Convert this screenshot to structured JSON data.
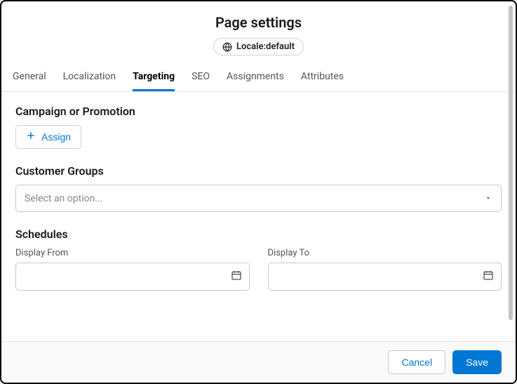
{
  "header": {
    "title": "Page settings",
    "locale_label": "Locale:default"
  },
  "tabs": {
    "general": "General",
    "localization": "Localization",
    "targeting": "Targeting",
    "seo": "SEO",
    "assignments": "Assignments",
    "attributes": "Attributes"
  },
  "campaign": {
    "title": "Campaign or Promotion",
    "assign_label": "Assign"
  },
  "customer_groups": {
    "title": "Customer Groups",
    "placeholder": "Select an option..."
  },
  "schedules": {
    "title": "Schedules",
    "from_label": "Display From",
    "to_label": "Display To"
  },
  "footer": {
    "cancel": "Cancel",
    "save": "Save"
  }
}
